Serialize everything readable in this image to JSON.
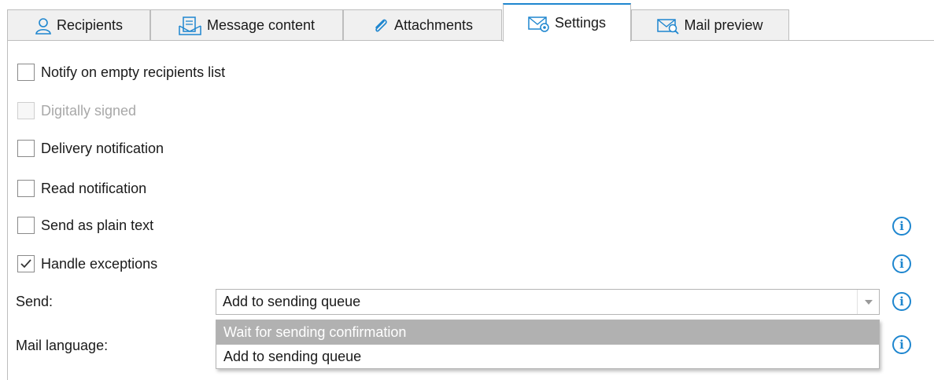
{
  "tabs": [
    {
      "label": "Recipients",
      "icon": "person-icon"
    },
    {
      "label": "Message content",
      "icon": "document-icon"
    },
    {
      "label": "Attachments",
      "icon": "paperclip-icon"
    },
    {
      "label": "Settings",
      "icon": "mail-gear-icon",
      "active": true
    },
    {
      "label": "Mail preview",
      "icon": "mail-search-icon"
    }
  ],
  "settings": {
    "notify_empty": {
      "label": "Notify on empty recipients list",
      "checked": false
    },
    "digitally_signed": {
      "label": "Digitally signed",
      "checked": false,
      "disabled": true
    },
    "delivery_notification": {
      "label": "Delivery notification",
      "checked": false
    },
    "read_notification": {
      "label": "Read notification",
      "checked": false
    },
    "send_plain_text": {
      "label": "Send as plain text",
      "checked": false
    },
    "handle_exceptions": {
      "label": "Handle exceptions",
      "checked": true
    },
    "send_label": "Send:",
    "send_value": "Add to sending queue",
    "send_options": [
      "Wait for sending confirmation",
      "Add to sending queue"
    ],
    "mail_language_label": "Mail language:"
  },
  "colors": {
    "accent": "#1e86cf",
    "highlight": "#b1b1b1"
  }
}
